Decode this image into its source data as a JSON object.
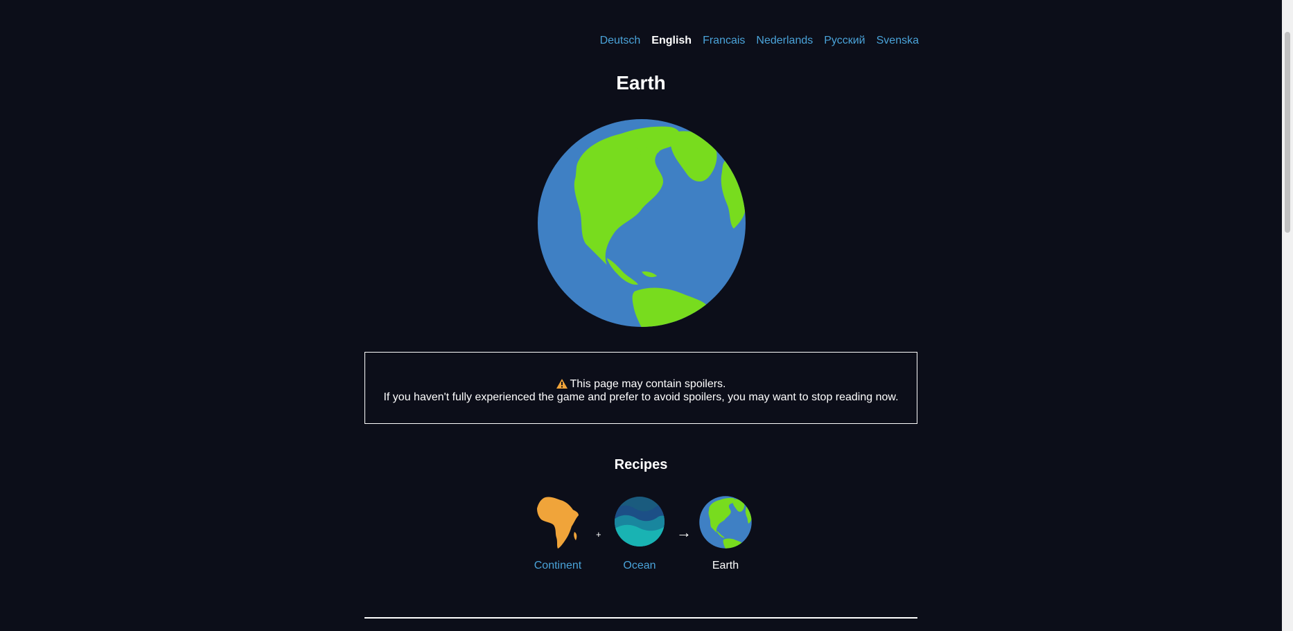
{
  "languages": [
    {
      "label": "Deutsch",
      "active": false
    },
    {
      "label": "English",
      "active": true
    },
    {
      "label": "Francais",
      "active": false
    },
    {
      "label": "Nederlands",
      "active": false
    },
    {
      "label": "Русский",
      "active": false
    },
    {
      "label": "Svenska",
      "active": false
    }
  ],
  "page_title": "Earth",
  "spoiler": {
    "line1": "This page may contain spoilers.",
    "line2": "If you haven't fully experienced the game and prefer to avoid spoilers, you may want to stop reading now."
  },
  "recipes": {
    "heading": "Recipes",
    "items": [
      {
        "ingredient1": "Continent",
        "operator_plus": "+",
        "ingredient2": "Ocean",
        "operator_arrow": "→",
        "result": "Earth"
      }
    ]
  },
  "colors": {
    "background": "#0c0e19",
    "link": "#4aa3d9",
    "ocean_blue": "#3f80c4",
    "land_green": "#78dc1e",
    "continent_orange": "#f0a43a",
    "ocean_teal": "#19b3b3",
    "warning_orange": "#f0a43a"
  },
  "icons": {
    "hero": "earth-globe-icon",
    "warning": "warning-triangle-icon",
    "continent": "africa-continent-icon",
    "ocean": "ocean-waves-icon",
    "earth": "earth-globe-icon"
  }
}
